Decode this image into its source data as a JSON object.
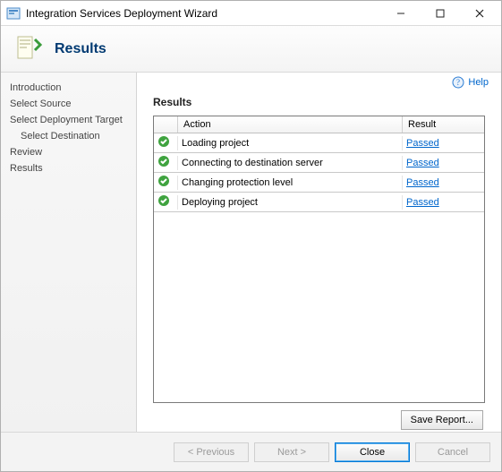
{
  "window": {
    "title": "Integration Services Deployment Wizard"
  },
  "header": {
    "title": "Results"
  },
  "help": {
    "label": "Help"
  },
  "sidebar": {
    "items": [
      {
        "label": "Introduction",
        "sub": false
      },
      {
        "label": "Select Source",
        "sub": false
      },
      {
        "label": "Select Deployment Target",
        "sub": false
      },
      {
        "label": "Select Destination",
        "sub": true
      },
      {
        "label": "Review",
        "sub": false
      },
      {
        "label": "Results",
        "sub": false
      }
    ]
  },
  "main": {
    "section_title": "Results",
    "columns": {
      "action": "Action",
      "result": "Result"
    },
    "rows": [
      {
        "action": "Loading project",
        "result": "Passed"
      },
      {
        "action": "Connecting to destination server",
        "result": "Passed"
      },
      {
        "action": "Changing protection level",
        "result": "Passed"
      },
      {
        "action": "Deploying project",
        "result": "Passed"
      }
    ],
    "save_report": "Save Report..."
  },
  "footer": {
    "previous": "< Previous",
    "next": "Next >",
    "close": "Close",
    "cancel": "Cancel"
  }
}
